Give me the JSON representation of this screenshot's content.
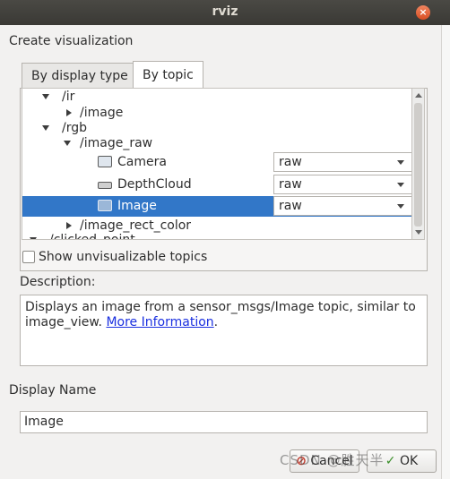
{
  "window": {
    "title": "rviz",
    "close_glyph": "×"
  },
  "section": {
    "create_label": "Create visualization"
  },
  "tabs": [
    {
      "label": "By display type",
      "active": false
    },
    {
      "label": "By topic",
      "active": true
    }
  ],
  "tree": {
    "rows": [
      {
        "label": "/ir"
      },
      {
        "label": "/image"
      },
      {
        "label": "/rgb"
      },
      {
        "label": "/image_raw"
      },
      {
        "label": "Camera",
        "combo": "raw"
      },
      {
        "label": "DepthCloud",
        "combo": "raw"
      },
      {
        "label": "Image",
        "combo": "raw",
        "selected": true
      },
      {
        "label": "/image_rect_color"
      },
      {
        "label": "/clicked_point"
      }
    ]
  },
  "options": {
    "show_unvisualizable": "Show unvisualizable topics"
  },
  "description": {
    "label": "Description:",
    "text": "Displays an image from a sensor_msgs/Image topic, similar to image_view. ",
    "link": "More Information",
    "suffix": "."
  },
  "display_name": {
    "label": "Display Name",
    "value": "Image"
  },
  "buttons": {
    "cancel": "Cancel",
    "ok": "OK"
  },
  "watermark": "CSDN @胜天半",
  "colors": {
    "selection": "#3277c8",
    "link": "#1a2fe0",
    "titlebar": "#3a3935"
  }
}
